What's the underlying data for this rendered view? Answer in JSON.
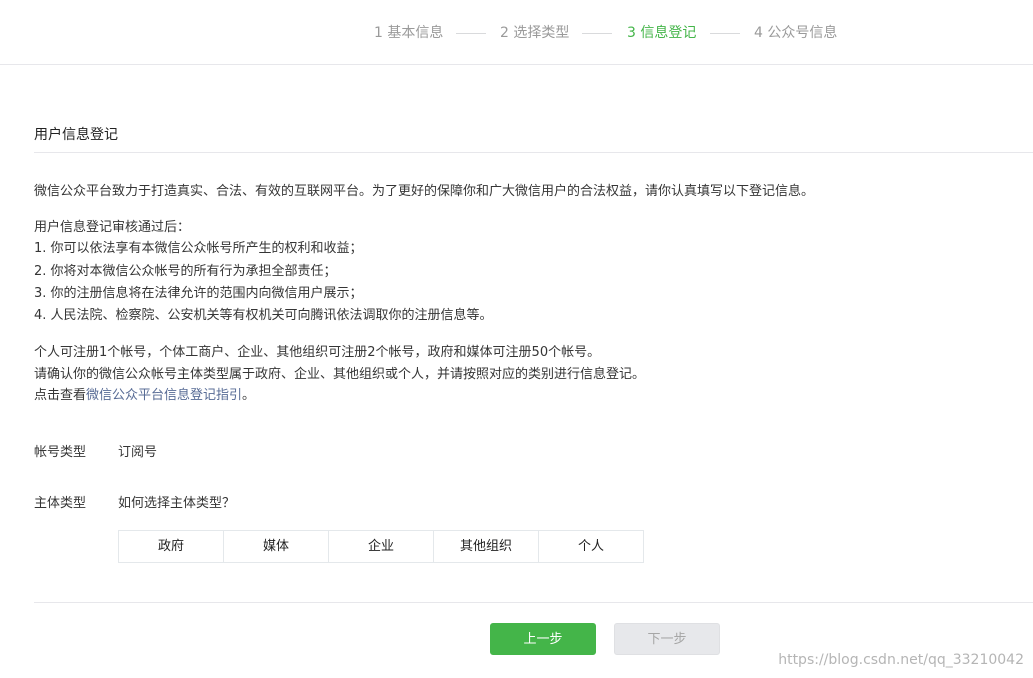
{
  "steps": [
    {
      "label": "1 基本信息",
      "state": "done"
    },
    {
      "label": "2 选择类型",
      "state": "done"
    },
    {
      "label": "3 信息登记",
      "state": "active"
    },
    {
      "label": "4 公众号信息",
      "state": "todo"
    }
  ],
  "section": {
    "title": "用户信息登记"
  },
  "intro": "微信公众平台致力于打造真实、合法、有效的互联网平台。为了更好的保障你和广大微信用户的合法权益，请你认真填写以下登记信息。",
  "review": {
    "heading": "用户信息登记审核通过后：",
    "items": [
      "1. 你可以依法享有本微信公众帐号所产生的权利和收益；",
      "2. 你将对本微信公众帐号的所有行为承担全部责任；",
      "3. 你的注册信息将在法律允许的范围内向微信用户展示；",
      "4. 人民法院、检察院、公安机关等有权机关可向腾讯依法调取你的注册信息等。"
    ]
  },
  "notes": {
    "line1": "个人可注册1个帐号，个体工商户、企业、其他组织可注册2个帐号，政府和媒体可注册50个帐号。",
    "line2": "请确认你的微信公众帐号主体类型属于政府、企业、其他组织或个人，并请按照对应的类别进行信息登记。",
    "guide_prefix": "点击查看",
    "guide_link": "微信公众平台信息登记指引",
    "guide_suffix": "。"
  },
  "form": {
    "account_type_label": "帐号类型",
    "account_type_value": "订阅号",
    "subject_type_label": "主体类型",
    "subject_help_link": "如何选择主体类型？",
    "subject_options": [
      "政府",
      "媒体",
      "企业",
      "其他组织",
      "个人"
    ]
  },
  "buttons": {
    "prev": "上一步",
    "next": "下一步"
  },
  "colors": {
    "accent": "#44b549",
    "link": "#576b95",
    "muted": "#9a9a9a"
  },
  "watermark": "https://blog.csdn.net/qq_33210042"
}
